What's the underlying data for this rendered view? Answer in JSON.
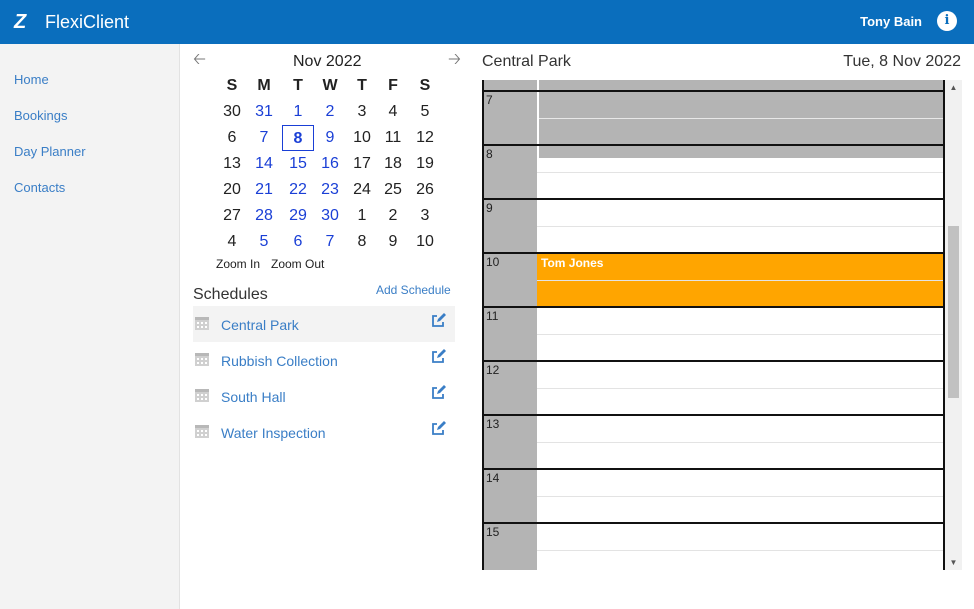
{
  "header": {
    "app_title": "FlexiClient",
    "user_name": "Tony Bain",
    "brand_color": "#0a6ebd"
  },
  "sidebar": {
    "items": [
      {
        "label": "Home"
      },
      {
        "label": "Bookings"
      },
      {
        "label": "Day Planner"
      },
      {
        "label": "Contacts"
      }
    ]
  },
  "calendar": {
    "month_label": "Nov 2022",
    "weekdays": [
      "S",
      "M",
      "T",
      "W",
      "T",
      "F",
      "S"
    ],
    "weeks": [
      [
        "30",
        "31",
        "1",
        "2",
        "3",
        "4",
        "5"
      ],
      [
        "6",
        "7",
        "8",
        "9",
        "10",
        "11",
        "12"
      ],
      [
        "13",
        "14",
        "15",
        "16",
        "17",
        "18",
        "19"
      ],
      [
        "20",
        "21",
        "22",
        "23",
        "24",
        "25",
        "26"
      ],
      [
        "27",
        "28",
        "29",
        "30",
        "1",
        "2",
        "3"
      ],
      [
        "4",
        "5",
        "6",
        "7",
        "8",
        "9",
        "10"
      ]
    ],
    "selected": "8",
    "zoom_in": "Zoom In",
    "zoom_out": "Zoom Out"
  },
  "schedules": {
    "title": "Schedules",
    "add_label": "Add Schedule",
    "items": [
      {
        "label": "Central Park"
      },
      {
        "label": "Rubbish Collection"
      },
      {
        "label": "South Hall"
      },
      {
        "label": "Water Inspection"
      }
    ]
  },
  "day_view": {
    "room": "Central Park",
    "date": "Tue, 8 Nov 2022",
    "hours": [
      "7",
      "8",
      "9",
      "10",
      "11",
      "12",
      "13",
      "14",
      "15"
    ],
    "booking": {
      "name": "Tom Jones",
      "color": "#ffa500"
    }
  }
}
